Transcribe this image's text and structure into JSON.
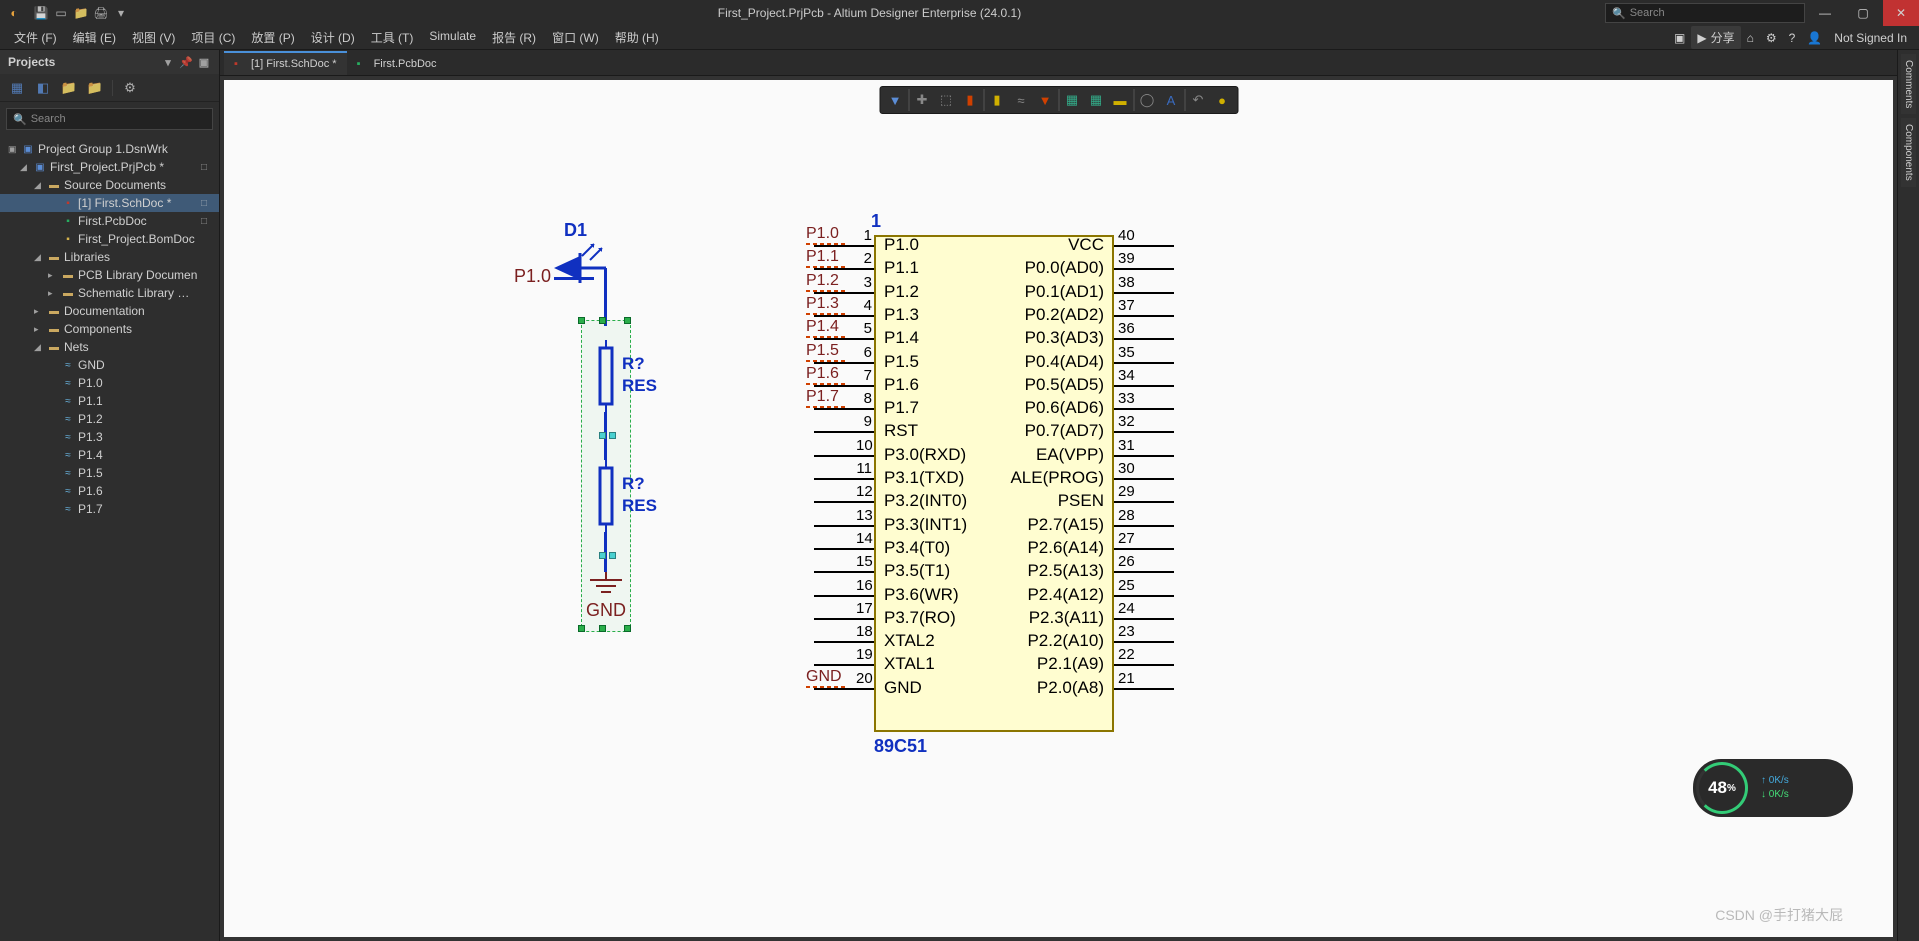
{
  "title": "First_Project.PrjPcb - Altium Designer Enterprise (24.0.1)",
  "search_placeholder": "Search",
  "menubar": [
    "文件 (F)",
    "编辑 (E)",
    "视图 (V)",
    "项目 (C)",
    "放置 (P)",
    "设计 (D)",
    "工具 (T)",
    "Simulate",
    "报告 (R)",
    "窗口 (W)",
    "帮助 (H)"
  ],
  "share_label": "分享",
  "sign_in": "Not Signed In",
  "panel_title": "Projects",
  "panel_search_placeholder": "Search",
  "tree": {
    "root": "Project Group 1.DsnWrk",
    "project": "First_Project.PrjPcb *",
    "src_folder": "Source Documents",
    "docs": [
      {
        "name": "[1] First.SchDoc *",
        "type": "sch",
        "sel": true,
        "stat": "□"
      },
      {
        "name": "First.PcbDoc",
        "type": "pcb",
        "stat": "□"
      },
      {
        "name": "First_Project.BomDoc",
        "type": "bom"
      }
    ],
    "libraries": "Libraries",
    "lib_items": [
      "PCB Library Documen",
      "Schematic Library Doc"
    ],
    "other": [
      "Documentation",
      "Components"
    ],
    "nets_label": "Nets",
    "nets": [
      "GND",
      "P1.0",
      "P1.1",
      "P1.2",
      "P1.3",
      "P1.4",
      "P1.5",
      "P1.6",
      "P1.7"
    ]
  },
  "tabs": [
    {
      "label": "[1] First.SchDoc *",
      "type": "sch",
      "active": true
    },
    {
      "label": "First.PcbDoc",
      "type": "pcb",
      "active": false
    }
  ],
  "schematic": {
    "net_p10": "P1.0",
    "d1": "D1",
    "r1": {
      "des": "R?",
      "val": "RES"
    },
    "r2": {
      "des": "R?",
      "val": "RES"
    },
    "gnd": "GND",
    "ic": {
      "ref": "1",
      "type": "89C51",
      "left_pins": [
        {
          "n": "1",
          "name": "P1.0",
          "err": "P1.0"
        },
        {
          "n": "2",
          "name": "P1.1",
          "err": "P1.1"
        },
        {
          "n": "3",
          "name": "P1.2",
          "err": "P1.2"
        },
        {
          "n": "4",
          "name": "P1.3",
          "err": "P1.3"
        },
        {
          "n": "5",
          "name": "P1.4",
          "err": "P1.4"
        },
        {
          "n": "6",
          "name": "P1.5",
          "err": "P1.5"
        },
        {
          "n": "7",
          "name": "P1.6",
          "err": "P1.6"
        },
        {
          "n": "8",
          "name": "P1.7",
          "err": "P1.7"
        },
        {
          "n": "9",
          "name": "RST"
        },
        {
          "n": "10",
          "name": "P3.0(RXD)"
        },
        {
          "n": "11",
          "name": "P3.1(TXD)"
        },
        {
          "n": "12",
          "name": "P3.2(INT0)"
        },
        {
          "n": "13",
          "name": "P3.3(INT1)"
        },
        {
          "n": "14",
          "name": "P3.4(T0)"
        },
        {
          "n": "15",
          "name": "P3.5(T1)"
        },
        {
          "n": "16",
          "name": "P3.6(WR)"
        },
        {
          "n": "17",
          "name": "P3.7(RO)"
        },
        {
          "n": "18",
          "name": "XTAL2"
        },
        {
          "n": "19",
          "name": "XTAL1"
        },
        {
          "n": "20",
          "name": "GND",
          "err": "GND"
        }
      ],
      "right_pins": [
        {
          "n": "40",
          "name": "VCC"
        },
        {
          "n": "39",
          "name": "P0.0(AD0)"
        },
        {
          "n": "38",
          "name": "P0.1(AD1)"
        },
        {
          "n": "37",
          "name": "P0.2(AD2)"
        },
        {
          "n": "36",
          "name": "P0.3(AD3)"
        },
        {
          "n": "35",
          "name": "P0.4(AD4)"
        },
        {
          "n": "34",
          "name": "P0.5(AD5)"
        },
        {
          "n": "33",
          "name": "P0.6(AD6)"
        },
        {
          "n": "32",
          "name": "P0.7(AD7)"
        },
        {
          "n": "31",
          "name": "EA(VPP)"
        },
        {
          "n": "30",
          "name": "ALE(PROG)"
        },
        {
          "n": "29",
          "name": "PSEN"
        },
        {
          "n": "28",
          "name": "P2.7(A15)"
        },
        {
          "n": "27",
          "name": "P2.6(A14)"
        },
        {
          "n": "26",
          "name": "P2.5(A13)"
        },
        {
          "n": "25",
          "name": "P2.4(A12)"
        },
        {
          "n": "24",
          "name": "P2.3(A11)"
        },
        {
          "n": "23",
          "name": "P2.2(A10)"
        },
        {
          "n": "22",
          "name": "P2.1(A9)"
        },
        {
          "n": "21",
          "name": "P2.0(A8)"
        }
      ]
    }
  },
  "right_tabs": [
    "Comments",
    "Components"
  ],
  "perf": {
    "pct": "48",
    "unit": "%",
    "up": "0K/s",
    "down": "0K/s"
  },
  "watermark": "CSDN @手打猪大屁"
}
